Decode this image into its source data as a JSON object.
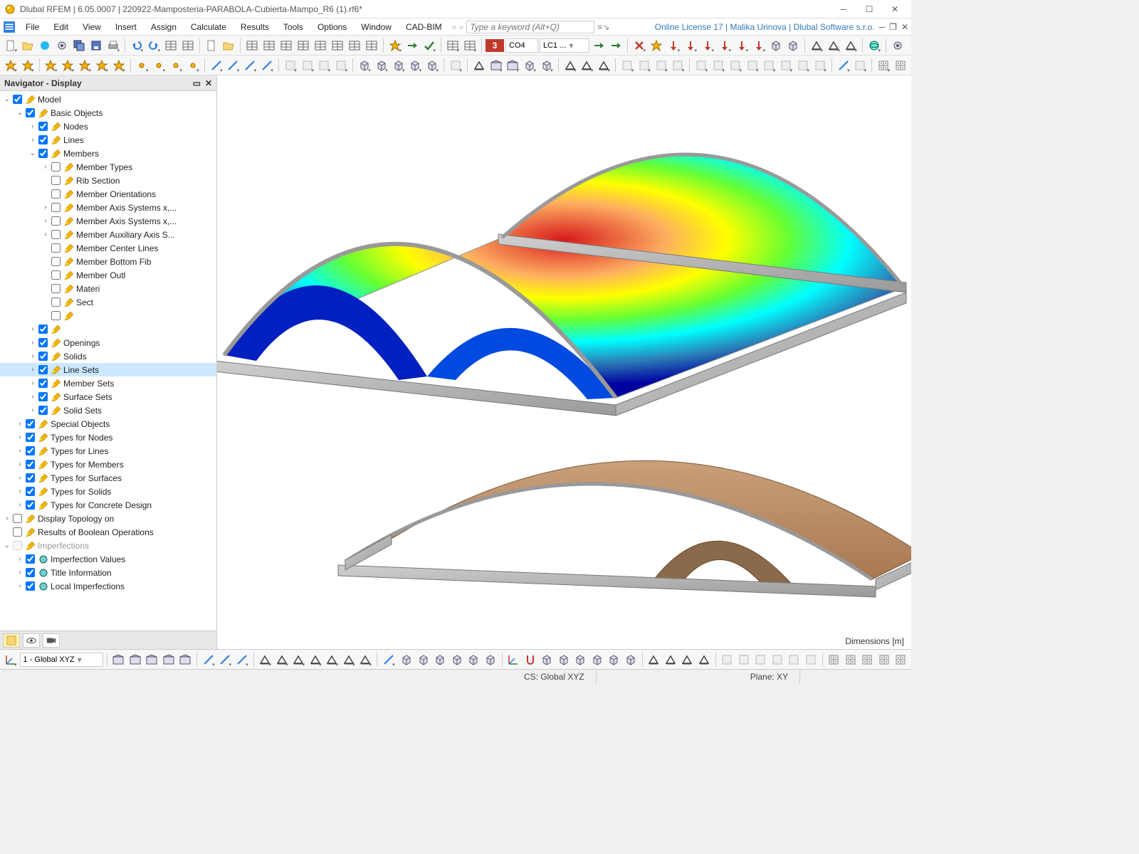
{
  "titlebar": {
    "app": "Dlubal RFEM",
    "version": "6.05.0007",
    "file": "220922-Mamposteria-PARABOLA-Cubierta-Mampo_R6 (1).rf6*"
  },
  "menu": [
    "File",
    "Edit",
    "View",
    "Insert",
    "Assign",
    "Calculate",
    "Results",
    "Tools",
    "Options",
    "Window",
    "CAD-BIM"
  ],
  "keyword_placeholder": "Type a keyword (Alt+Q)",
  "license": "Online License 17 | Malika Urinova | Dlubal Software s.r.o.",
  "lc": {
    "red_num": "3",
    "co": "CO4",
    "lc": "LC1 ..."
  },
  "navigator": {
    "title": "Navigator - Display",
    "tree": [
      {
        "d": 0,
        "exp": true,
        "cb": true,
        "lbl": "Model",
        "icon": "pencil"
      },
      {
        "d": 1,
        "exp": true,
        "cb": true,
        "lbl": "Basic Objects",
        "icon": "pencil"
      },
      {
        "d": 2,
        "exp": false,
        "cb": true,
        "lbl": "Nodes",
        "icon": "pencil",
        "arrow": true
      },
      {
        "d": 2,
        "exp": false,
        "cb": true,
        "lbl": "Lines",
        "icon": "pencil",
        "arrow": true
      },
      {
        "d": 2,
        "exp": true,
        "cb": true,
        "lbl": "Members",
        "icon": "pencil"
      },
      {
        "d": 3,
        "exp": false,
        "cb": false,
        "lbl": "Member Types",
        "icon": "pencil",
        "arrow": true,
        "box": "blue"
      },
      {
        "d": 3,
        "cb": false,
        "lbl": "Rib Section",
        "icon": "pencil"
      },
      {
        "d": 3,
        "cb": false,
        "lbl": "Member Orientations",
        "icon": "pencil"
      },
      {
        "d": 3,
        "exp": false,
        "cb": false,
        "lbl": "Member Axis Systems x,...",
        "icon": "pencil",
        "arrow": true
      },
      {
        "d": 3,
        "exp": false,
        "cb": false,
        "lbl": "Member Axis Systems x,...",
        "icon": "pencil",
        "arrow": true
      },
      {
        "d": 3,
        "exp": false,
        "cb": false,
        "lbl": "Member Auxiliary Axis S...",
        "icon": "pencil",
        "arrow": true
      },
      {
        "d": 3,
        "cb": false,
        "lbl": "Member Center Lines",
        "icon": "pencil"
      },
      {
        "d": 3,
        "cb": false,
        "lbl": "Member Bottom Fib",
        "icon": "pencil",
        "cut": true
      },
      {
        "d": 3,
        "cb": false,
        "lbl": "Member Outl",
        "icon": "pencil",
        "cut": true
      },
      {
        "d": 3,
        "cb": false,
        "lbl": "Materi",
        "icon": "pencil",
        "cut": true
      },
      {
        "d": 3,
        "cb": false,
        "lbl": "Sect",
        "icon": "pencil",
        "cut": true
      },
      {
        "d": 3,
        "cb": false,
        "lbl": "",
        "icon": "pencil",
        "cut": true
      },
      {
        "d": 2,
        "exp": false,
        "cb": true,
        "lbl": "",
        "icon": "",
        "arrow": true,
        "cut": true
      },
      {
        "d": 2,
        "exp": false,
        "cb": true,
        "lbl": "Openings",
        "icon": "pencil",
        "arrow": true
      },
      {
        "d": 2,
        "exp": false,
        "cb": true,
        "lbl": "Solids",
        "icon": "pencil",
        "arrow": true
      },
      {
        "d": 2,
        "exp": false,
        "cb": true,
        "lbl": "Line Sets",
        "icon": "pencil",
        "arrow": true,
        "sel": true
      },
      {
        "d": 2,
        "exp": false,
        "cb": true,
        "lbl": "Member Sets",
        "icon": "pencil",
        "arrow": true
      },
      {
        "d": 2,
        "exp": false,
        "cb": true,
        "lbl": "Surface Sets",
        "icon": "pencil",
        "arrow": true
      },
      {
        "d": 2,
        "exp": false,
        "cb": true,
        "lbl": "Solid Sets",
        "icon": "pencil",
        "arrow": true
      },
      {
        "d": 1,
        "exp": false,
        "cb": true,
        "lbl": "Special Objects",
        "icon": "pencil",
        "arrow": true
      },
      {
        "d": 1,
        "exp": false,
        "cb": true,
        "lbl": "Types for Nodes",
        "icon": "pencil",
        "arrow": true
      },
      {
        "d": 1,
        "exp": false,
        "cb": true,
        "lbl": "Types for Lines",
        "icon": "pencil",
        "arrow": true
      },
      {
        "d": 1,
        "exp": false,
        "cb": true,
        "lbl": "Types for Members",
        "icon": "pencil",
        "arrow": true
      },
      {
        "d": 1,
        "exp": false,
        "cb": true,
        "lbl": "Types for Surfaces",
        "icon": "pencil",
        "arrow": true
      },
      {
        "d": 1,
        "exp": false,
        "cb": true,
        "lbl": "Types for Solids",
        "icon": "pencil",
        "arrow": true
      },
      {
        "d": 1,
        "exp": false,
        "cb": true,
        "lbl": "Types for Concrete Design",
        "icon": "pencil",
        "arrow": true
      },
      {
        "d": 0,
        "exp": false,
        "cb": false,
        "lbl": "Display Topology on",
        "icon": "pencil",
        "arrow": true,
        "box": "blue"
      },
      {
        "d": 0,
        "cb": false,
        "lbl": "Results of Boolean Operations",
        "icon": "pencil"
      },
      {
        "d": 0,
        "exp": true,
        "cb": false,
        "lbl": "Imperfections",
        "icon": "pencil",
        "dim": true,
        "disabled": true
      },
      {
        "d": 1,
        "exp": false,
        "cb": true,
        "lbl": "Imperfection Values",
        "icon": "imp",
        "arrow": true
      },
      {
        "d": 1,
        "exp": false,
        "cb": true,
        "lbl": "Title Information",
        "icon": "imp",
        "arrow": true
      },
      {
        "d": 1,
        "exp": false,
        "cb": true,
        "lbl": "Local Imperfections",
        "icon": "imp",
        "arrow": true
      }
    ]
  },
  "viewport": {
    "dimensions_label": "Dimensions [m]"
  },
  "bottom_combo": "1 - Global XYZ",
  "status": {
    "cs": "CS: Global XYZ",
    "plane": "Plane: XY"
  }
}
